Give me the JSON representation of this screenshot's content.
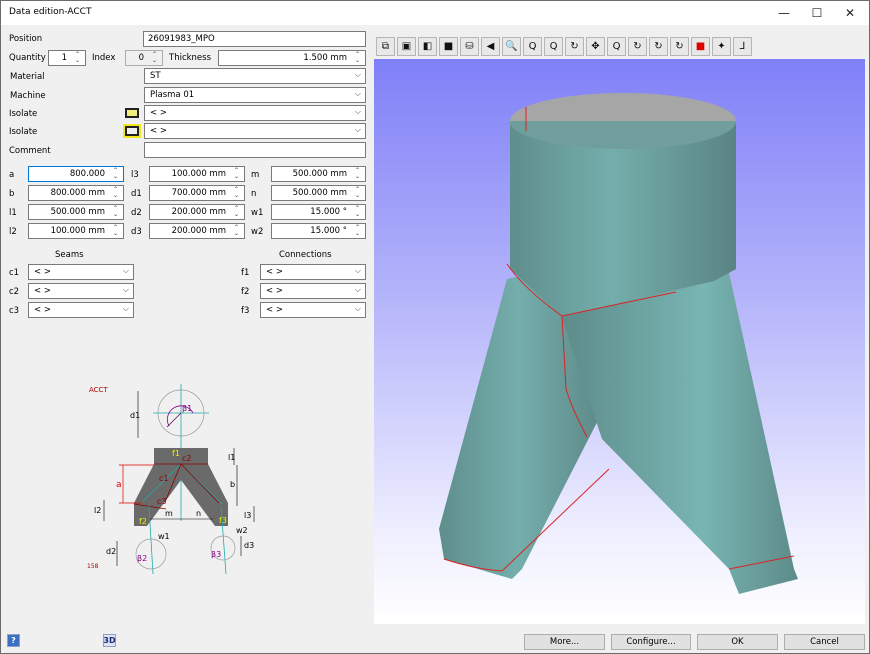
{
  "window": {
    "title": "Data edition-ACCT",
    "minimize_icon": "minimize-icon",
    "maximize_icon": "maximize-icon",
    "close_icon": "close-icon"
  },
  "form": {
    "position": {
      "label": "Position",
      "value": "26091983_MPO"
    },
    "quantity": {
      "label": "Quantity",
      "value": "1"
    },
    "index": {
      "label": "Index",
      "value": "0"
    },
    "thickness": {
      "label": "Thickness",
      "value": "1.500 mm"
    },
    "material": {
      "label": "Material",
      "value": "ST"
    },
    "machine": {
      "label": "Machine",
      "value": "Plasma 01"
    },
    "isolate1": {
      "label": "Isolate",
      "value": "< >",
      "swatch_color": "#f2f07a"
    },
    "isolate2": {
      "label": "Isolate",
      "value": "< >",
      "swatch_color": "#f0f0f0"
    },
    "comment": {
      "label": "Comment",
      "value": ""
    }
  },
  "params": {
    "col1": [
      {
        "label": "a",
        "value": "800.000"
      },
      {
        "label": "b",
        "value": "800.000 mm"
      },
      {
        "label": "l1",
        "value": "500.000 mm"
      },
      {
        "label": "l2",
        "value": "100.000 mm"
      }
    ],
    "col2": [
      {
        "label": "l3",
        "value": "100.000 mm"
      },
      {
        "label": "d1",
        "value": "700.000 mm"
      },
      {
        "label": "d2",
        "value": "200.000 mm"
      },
      {
        "label": "d3",
        "value": "200.000 mm"
      }
    ],
    "col3": [
      {
        "label": "m",
        "value": "500.000 mm"
      },
      {
        "label": "n",
        "value": "500.000 mm"
      },
      {
        "label": "w1",
        "value": "15.000 °"
      },
      {
        "label": "w2",
        "value": "15.000 °"
      }
    ]
  },
  "seams": {
    "header": "Seams",
    "items": [
      {
        "label": "c1",
        "value": "< >"
      },
      {
        "label": "c2",
        "value": "< >"
      },
      {
        "label": "c3",
        "value": "< >"
      }
    ]
  },
  "connections": {
    "header": "Connections",
    "items": [
      {
        "label": "f1",
        "value": "< >"
      },
      {
        "label": "f2",
        "value": "< >"
      },
      {
        "label": "f3",
        "value": "< >"
      }
    ]
  },
  "diagram": {
    "title": "ACCT",
    "code": "158",
    "labels": {
      "d1": "d1",
      "beta1": "β1",
      "f1": "f1",
      "c2": "c2",
      "l1": "l1",
      "a": "a",
      "c1": "c1",
      "b": "b",
      "c3": "c3",
      "l2": "l2",
      "l3": "l3",
      "m": "m",
      "n": "n",
      "f2": "f2",
      "f3": "f3",
      "w1": "w1",
      "w2": "w2",
      "d2": "d2",
      "d3": "d3",
      "beta2": "β2",
      "beta3": "β3"
    }
  },
  "toolbar": {
    "buttons": [
      {
        "name": "view-wireframe-icon",
        "glyph": "⧉"
      },
      {
        "name": "view-shaded-icon",
        "glyph": "▣"
      },
      {
        "name": "view-solid-icon",
        "glyph": "◧"
      },
      {
        "name": "view-front-icon",
        "glyph": "■"
      },
      {
        "name": "view-cylinder-icon",
        "glyph": "⛁"
      },
      {
        "name": "view-perspective-icon",
        "glyph": "◀"
      },
      {
        "name": "zoom-icon",
        "glyph": "🔍"
      },
      {
        "name": "zoom-window-icon",
        "glyph": "Q"
      },
      {
        "name": "zoom-out-icon",
        "glyph": "Q"
      },
      {
        "name": "rotate-icon",
        "glyph": "↻"
      },
      {
        "name": "pan-icon",
        "glyph": "✥"
      },
      {
        "name": "zoom-fit-icon",
        "glyph": "Q"
      },
      {
        "name": "rotate-x-icon",
        "glyph": "↻"
      },
      {
        "name": "rotate-y-icon",
        "glyph": "↻"
      },
      {
        "name": "rotate-z-icon",
        "glyph": "↻"
      },
      {
        "name": "color-icon",
        "glyph": "■"
      },
      {
        "name": "view-reset-icon",
        "glyph": "✦"
      },
      {
        "name": "axes-icon",
        "glyph": "⅃"
      }
    ]
  },
  "footer": {
    "help_label": "?",
    "threed_label": "3D",
    "more_label": "More...",
    "configure_label": "Configure...",
    "ok_label": "OK",
    "cancel_label": "Cancel"
  }
}
